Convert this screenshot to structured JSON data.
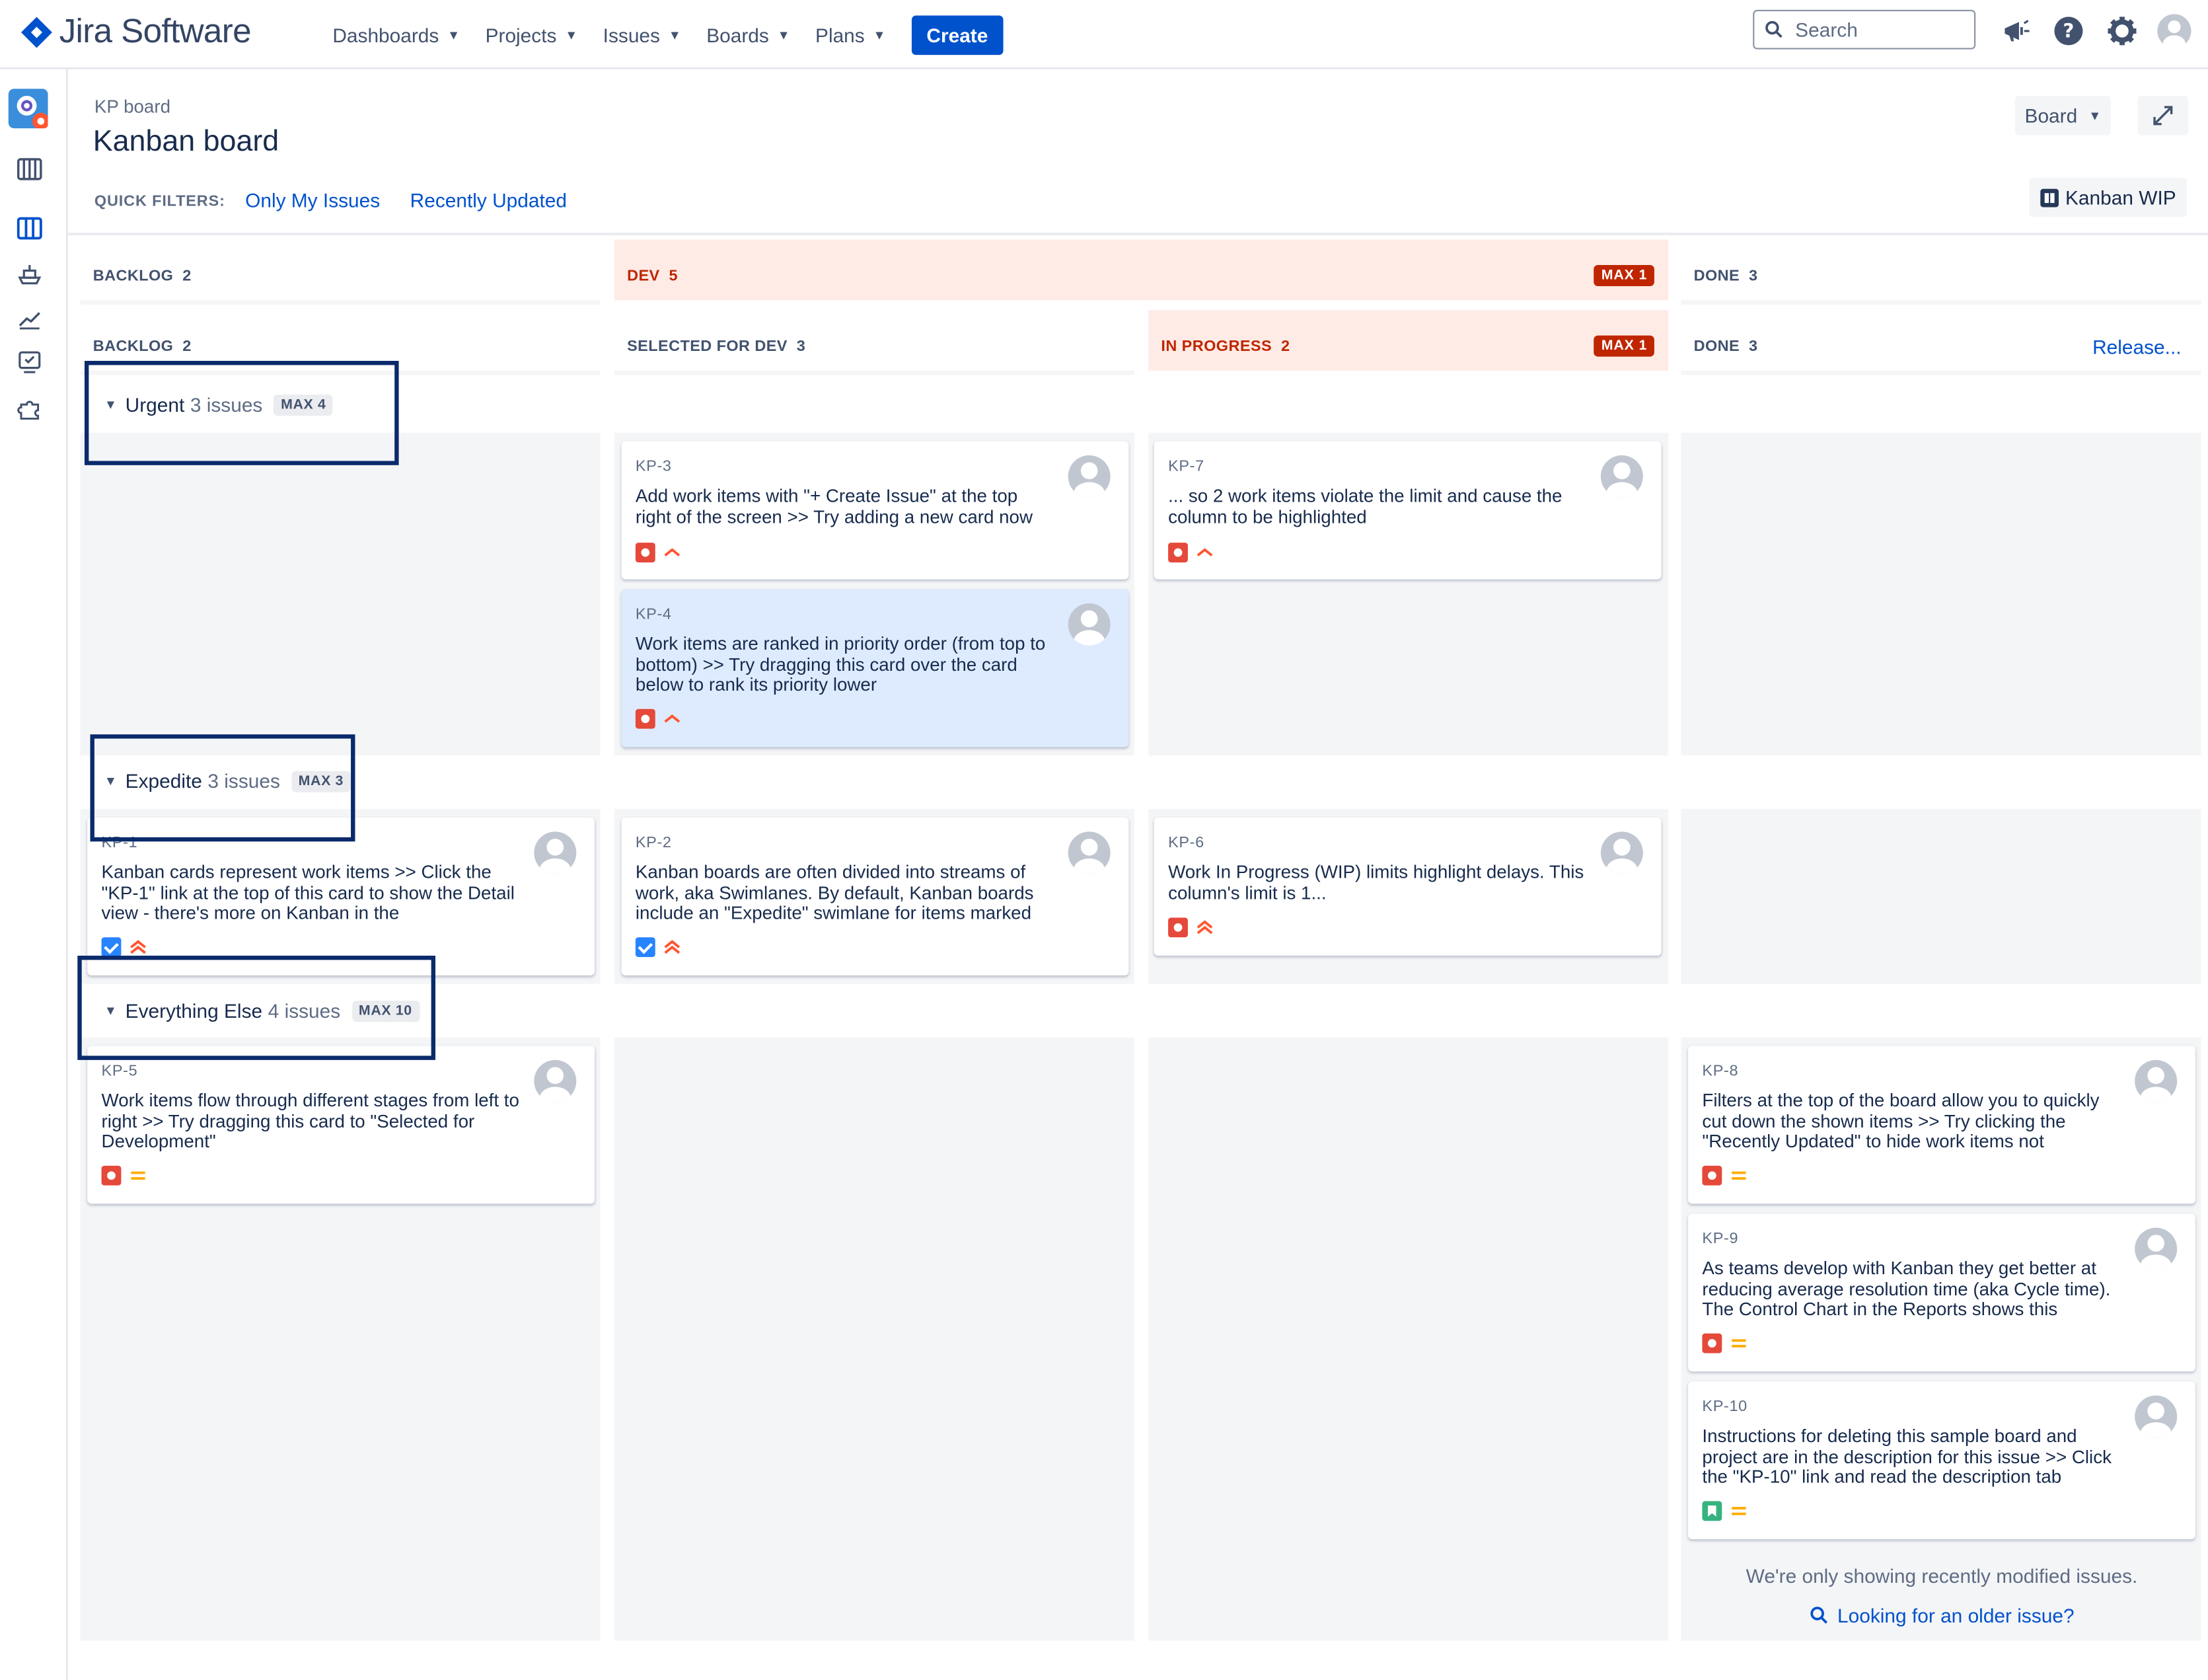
{
  "app": {
    "name": "Jira Software",
    "brand_color": "#0052cc"
  },
  "nav": {
    "items": [
      {
        "label": "Dashboards"
      },
      {
        "label": "Projects"
      },
      {
        "label": "Issues"
      },
      {
        "label": "Boards"
      },
      {
        "label": "Plans"
      }
    ],
    "create_label": "Create",
    "search_placeholder": "Search",
    "icons": [
      "notifications-icon",
      "help-icon",
      "settings-icon",
      "user-avatar"
    ]
  },
  "sidebar": {
    "icons": [
      "project-avatar",
      "backlog-icon",
      "board-icon",
      "releases-icon",
      "reports-icon",
      "issues-icon",
      "add-ons-icon"
    ]
  },
  "header": {
    "breadcrumb": "KP board",
    "title": "Kanban board",
    "board_button": "Board",
    "quick_filters_label": "QUICK FILTERS:",
    "quick_filters": [
      "Only My Issues",
      "Recently Updated"
    ],
    "wip_button": "Kanban WIP"
  },
  "columns_top": [
    {
      "title": "BACKLOG",
      "count": "2"
    },
    {
      "title": "DEV",
      "count": "5",
      "max": "MAX 1",
      "over_limit": true
    },
    {
      "title": "DONE",
      "count": "3"
    }
  ],
  "columns": [
    {
      "title": "BACKLOG",
      "count": "2"
    },
    {
      "title": "SELECTED FOR DEV",
      "count": "3"
    },
    {
      "title": "IN PROGRESS",
      "count": "2",
      "max": "MAX 1",
      "over_limit": true
    },
    {
      "title": "DONE",
      "count": "3",
      "action": "Release..."
    }
  ],
  "swimlanes": [
    {
      "name": "Urgent",
      "count": "3 issues",
      "max": "MAX 4"
    },
    {
      "name": "Expedite",
      "count": "3 issues",
      "max": "MAX 3"
    },
    {
      "name": "Everything Else",
      "count": "4 issues",
      "max": "MAX 10"
    }
  ],
  "cards": {
    "kp3": {
      "key": "KP-3",
      "summary": "Add work items with \"+ Create Issue\" at the top right of the screen >> Try adding a new card now",
      "type": "bug",
      "priority": "high"
    },
    "kp4": {
      "key": "KP-4",
      "summary": "Work items are ranked in priority order (from top to bottom) >> Try dragging this card over the card below to rank its priority lower",
      "type": "bug",
      "priority": "high",
      "selected": true
    },
    "kp7": {
      "key": "KP-7",
      "summary": "... so 2 work items violate the limit and cause the column to be highlighted",
      "type": "bug",
      "priority": "high"
    },
    "kp1": {
      "key": "KP-1",
      "summary": "Kanban cards represent work items >> Click the \"KP-1\" link at the top of this card to show the Detail view - there's more on Kanban in the",
      "type": "task",
      "priority": "highest"
    },
    "kp2": {
      "key": "KP-2",
      "summary": "Kanban boards are often divided into streams of work, aka Swimlanes. By default, Kanban boards include an \"Expedite\" swimlane for items marked",
      "type": "task",
      "priority": "highest"
    },
    "kp6": {
      "key": "KP-6",
      "summary": "Work In Progress (WIP) limits highlight delays. This column's limit is 1...",
      "type": "bug",
      "priority": "highest"
    },
    "kp5": {
      "key": "KP-5",
      "summary": "Work items flow through different stages from left to right >> Try dragging this card to \"Selected for Development\"",
      "type": "bug",
      "priority": "medium"
    },
    "kp8": {
      "key": "KP-8",
      "summary": "Filters at the top of the board allow you to quickly cut down the shown items >> Try clicking the \"Recently Updated\" to hide work items not",
      "type": "bug",
      "priority": "medium"
    },
    "kp9": {
      "key": "KP-9",
      "summary": "As teams develop with Kanban they get better at reducing average resolution time (aka Cycle time). The Control Chart in the Reports shows this",
      "type": "bug",
      "priority": "medium"
    },
    "kp10": {
      "key": "KP-10",
      "summary": "Instructions for deleting this sample board and project are in the description for this issue >> Click the \"KP-10\" link and read the description tab",
      "type": "story",
      "priority": "medium"
    }
  },
  "footer": {
    "note": "We're only showing recently modified issues.",
    "older_link": "Looking for an older issue?"
  },
  "colors": {
    "over_limit_bg": "#ffebe6",
    "over_limit_text": "#bf2600",
    "link": "#0052cc",
    "column_bg": "#f4f5f7"
  }
}
